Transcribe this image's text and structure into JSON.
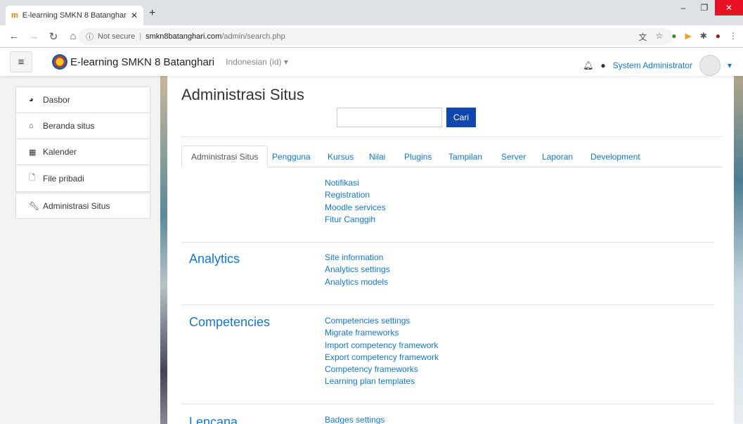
{
  "browser": {
    "tab_title": "E-learning SMKN 8 Batanghari: A",
    "url_secure_text": "Not secure",
    "url_host": "smkn8batanghari.com",
    "url_path": "/admin/search.php"
  },
  "header": {
    "site_name": "E-learning SMKN 8 Batanghari",
    "language": "Indonesian (id)",
    "user_name": "System Administrator"
  },
  "sidebar": {
    "items": [
      {
        "label": "Dasbor",
        "icon": "dashboard-icon"
      },
      {
        "label": "Beranda situs",
        "icon": "home-icon"
      },
      {
        "label": "Kalender",
        "icon": "calendar-icon"
      },
      {
        "label": "File pribadi",
        "icon": "file-icon"
      }
    ],
    "admin": {
      "label": "Administrasi Situs",
      "icon": "wrench-icon"
    }
  },
  "main": {
    "title": "Administrasi Situs",
    "search_button": "Cari",
    "tabs": [
      "Administrasi Situs",
      "Pengguna",
      "Kursus",
      "Nilai",
      "Plugins",
      "Tampilan",
      "Server",
      "Laporan",
      "Development"
    ],
    "top_links": [
      "Notifikasi",
      "Registration",
      "Moodle services",
      "Fitur Canggih"
    ],
    "sections": [
      {
        "title": "Analytics",
        "links": [
          "Site information",
          "Analytics settings",
          "Analytics models"
        ]
      },
      {
        "title": "Competencies",
        "links": [
          "Competencies settings",
          "Migrate frameworks",
          "Import competency framework",
          "Export competency framework",
          "Competency frameworks",
          "Learning plan templates"
        ]
      },
      {
        "title": "Lencana",
        "links": [
          "Badges settings"
        ]
      }
    ]
  }
}
